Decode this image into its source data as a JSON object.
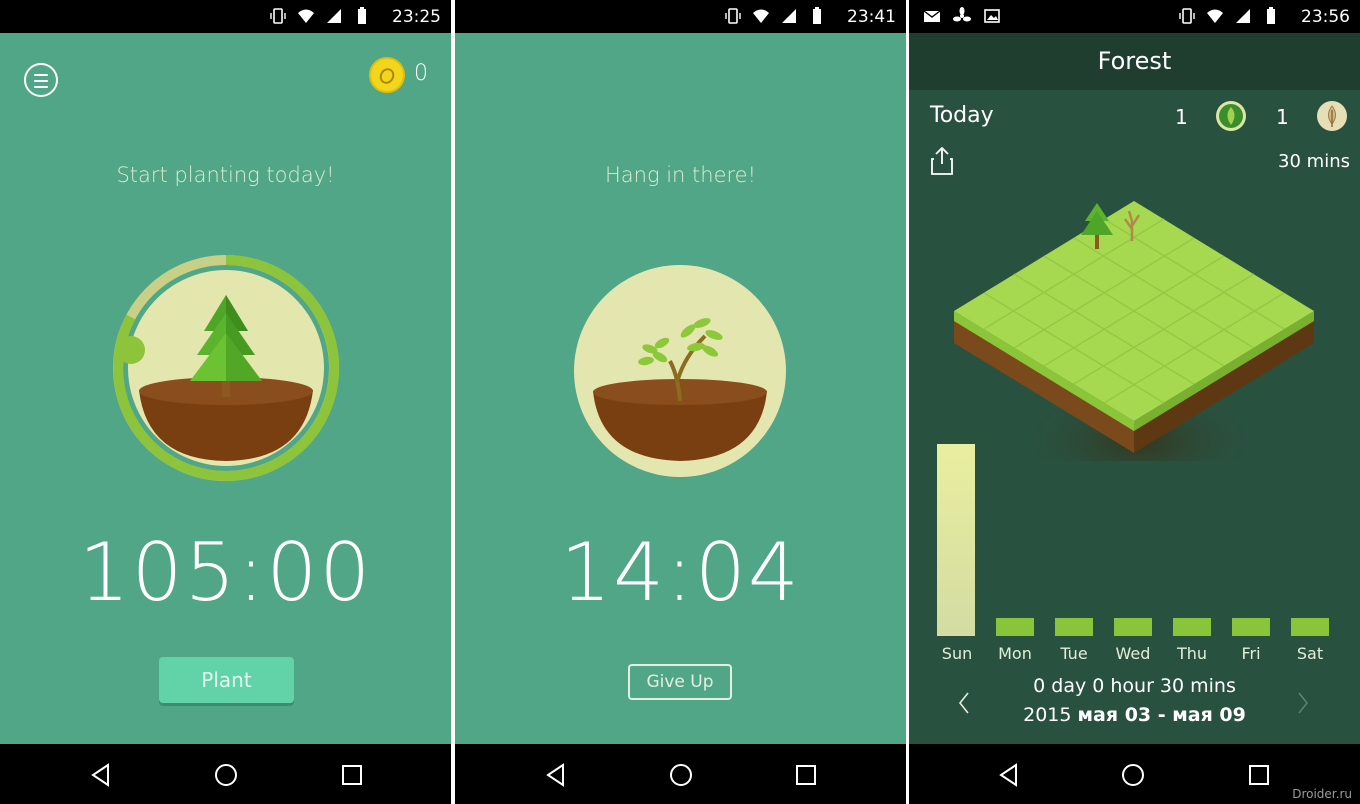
{
  "screens": [
    {
      "status_time": "23:25",
      "coin_count": "0",
      "headline": "Start planting today!",
      "timer": "105:00",
      "button_label": "Plant"
    },
    {
      "status_time": "23:41",
      "headline": "Hang in there!",
      "timer": "14:04",
      "button_label": "Give Up"
    },
    {
      "status_time": "23:56",
      "title": "Forest",
      "today_label": "Today",
      "healthy_count": "1",
      "withered_count": "1",
      "duration": "30 mins",
      "days": [
        "Sun",
        "Mon",
        "Tue",
        "Wed",
        "Thu",
        "Fri",
        "Sat"
      ],
      "day_values_mins": [
        30,
        0,
        0,
        0,
        0,
        0,
        0
      ],
      "summary_time": "0 day 0 hour 30 mins",
      "summary_range_prefix": "2015",
      "summary_range": "мая 03 - мая 09"
    }
  ],
  "watermark": "Droider.ru",
  "colors": {
    "teal": "#50a687",
    "forest_bg": "#29513f",
    "forest_header": "#1f3e30",
    "grass": "#8fd13f",
    "soil": "#8b4e1c",
    "sun_bar": "#e6eba4",
    "day_bar": "#8ac43a"
  },
  "icons": [
    "menu-icon",
    "coin-icon",
    "share-icon",
    "healthy-tree-icon",
    "withered-tree-icon",
    "back-icon",
    "home-icon",
    "recents-icon",
    "chevron-left-icon",
    "chevron-right-icon"
  ]
}
